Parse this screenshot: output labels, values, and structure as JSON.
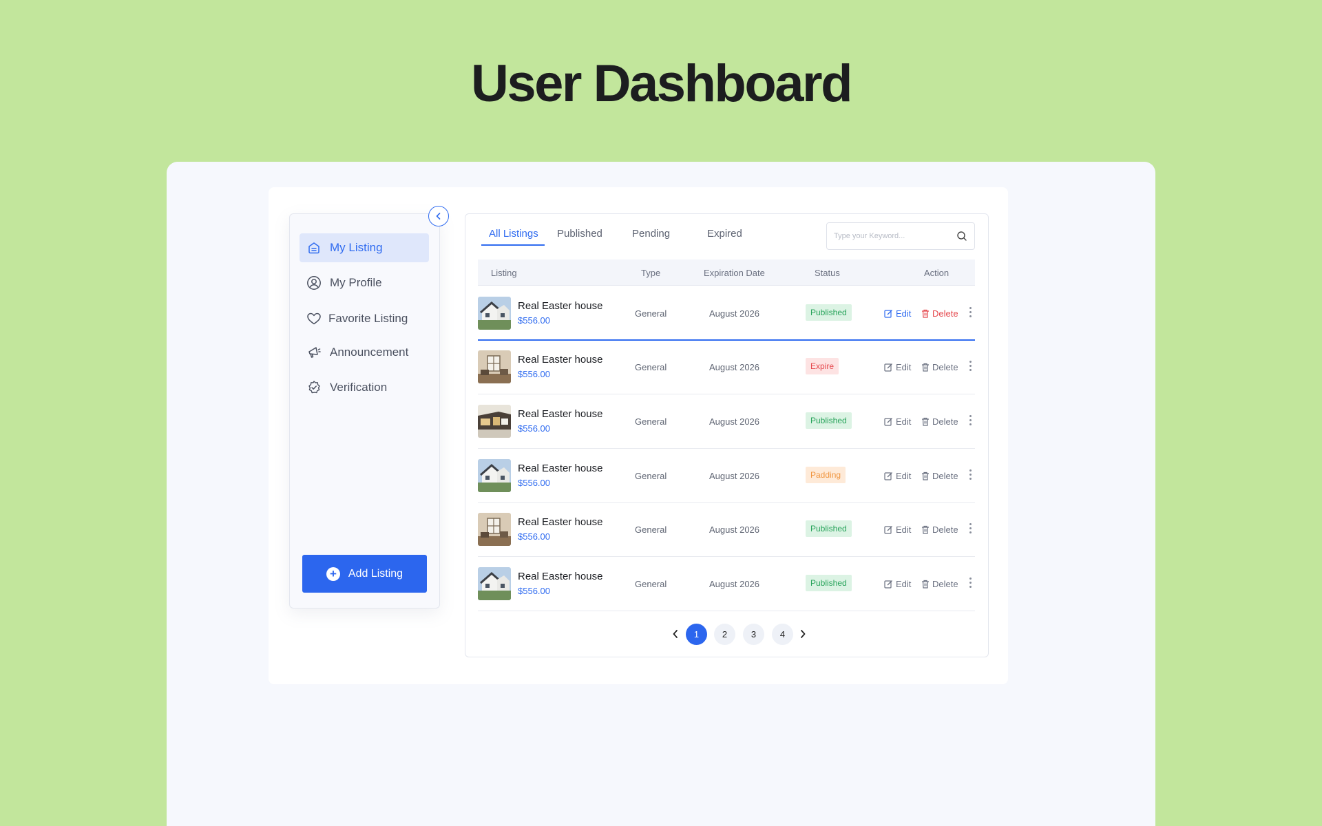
{
  "hero": {
    "title": "User Dashboard"
  },
  "sidebar": {
    "items": [
      {
        "label": "My Listing",
        "icon": "home-icon",
        "active": true
      },
      {
        "label": "My Profile",
        "icon": "user-circle-icon"
      },
      {
        "label": "Favorite Listing",
        "icon": "heart-icon"
      },
      {
        "label": "Announcement",
        "icon": "megaphone-icon"
      },
      {
        "label": "Verification",
        "icon": "verified-badge-icon"
      }
    ],
    "add_button": "Add Listing"
  },
  "tabs": [
    "All Listings",
    "Published",
    "Pending",
    "Expired"
  ],
  "search": {
    "placeholder": "Type your Keyword..."
  },
  "table": {
    "headers": [
      "Listing",
      "Type",
      "Expiration Date",
      "Status",
      "Action"
    ],
    "rows": [
      {
        "name": "Real Easter house",
        "price": "$556.00",
        "type": "General",
        "date": "August 2026",
        "status": "Published",
        "edit": "Edit",
        "delete": "Delete"
      },
      {
        "name": "Real Easter house",
        "price": "$556.00",
        "type": "General",
        "date": "August 2026",
        "status": "Expire",
        "edit": "Edit",
        "delete": "Delete"
      },
      {
        "name": "Real Easter house",
        "price": "$556.00",
        "type": "General",
        "date": "August 2026",
        "status": "Published",
        "edit": "Edit",
        "delete": "Delete"
      },
      {
        "name": "Real Easter house",
        "price": "$556.00",
        "type": "General",
        "date": "August 2026",
        "status": "Padding",
        "edit": "Edit",
        "delete": "Delete"
      },
      {
        "name": "Real Easter house",
        "price": "$556.00",
        "type": "General",
        "date": "August 2026",
        "status": "Published",
        "edit": "Edit",
        "delete": "Delete"
      },
      {
        "name": "Real Easter house",
        "price": "$556.00",
        "type": "General",
        "date": "August 2026",
        "status": "Published",
        "edit": "Edit",
        "delete": "Delete"
      }
    ]
  },
  "pagination": {
    "pages": [
      "1",
      "2",
      "3",
      "4"
    ],
    "current": "1"
  },
  "colors": {
    "background": "#c2e69c",
    "accent": "#2c66ee",
    "published": "#27a35a",
    "expire": "#e5484d",
    "padding": "#f0953f"
  }
}
